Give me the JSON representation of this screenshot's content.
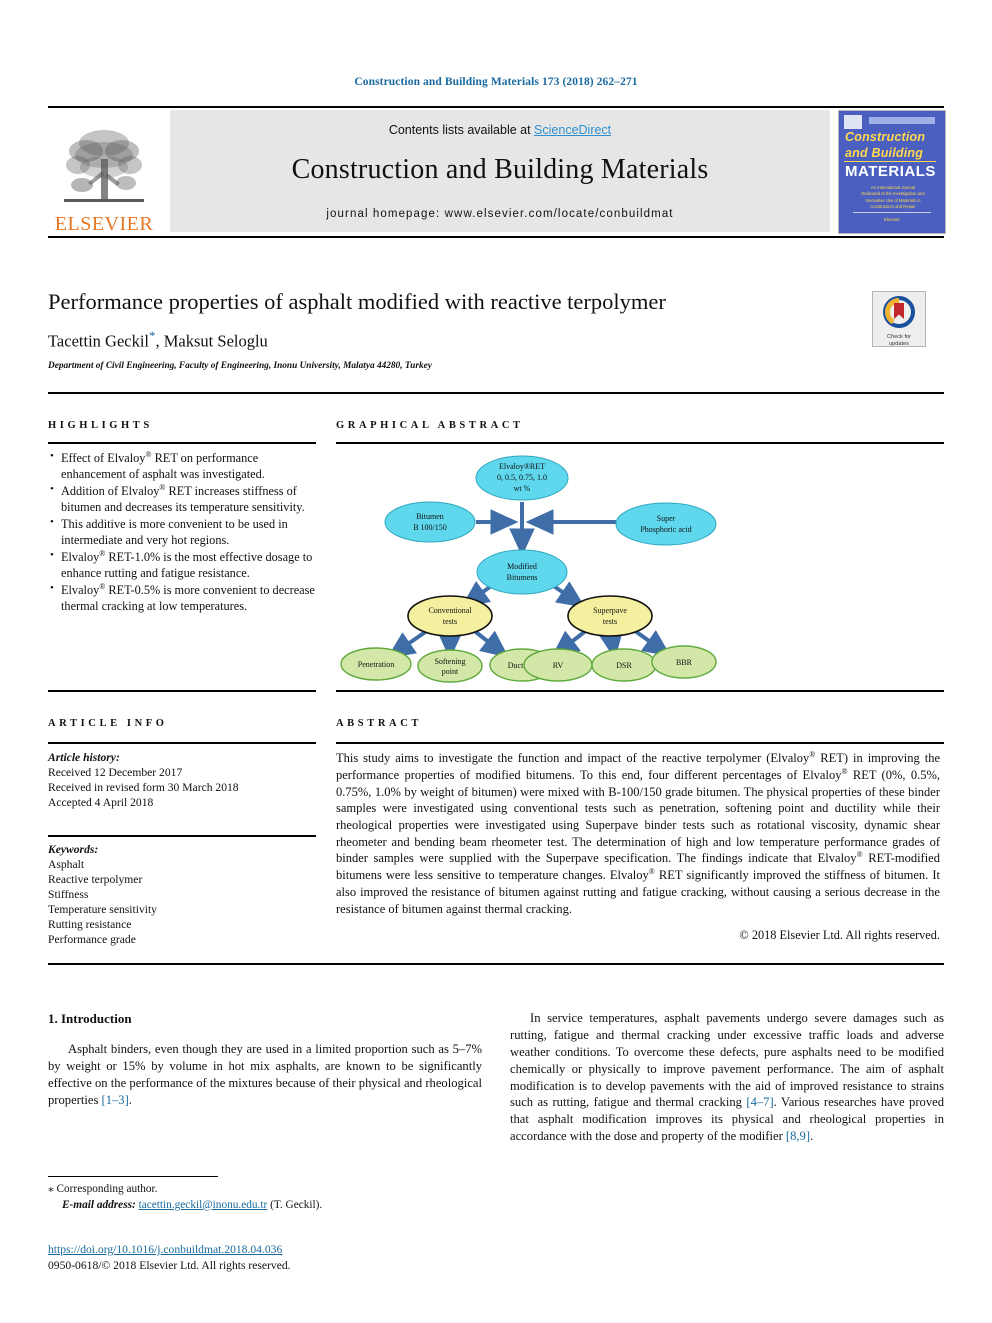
{
  "runninghead": "Construction and Building Materials 173 (2018) 262–271",
  "masthead": {
    "contents_prefix": "Contents lists available at ",
    "sciencedirect": "ScienceDirect",
    "journal_title": "Construction and Building Materials",
    "homepage": "journal homepage: www.elsevier.com/locate/conbuildmat",
    "publisher": "ELSEVIER",
    "cover": {
      "line1": "Construction",
      "line2": "and Building",
      "line3": "MATERIALS",
      "blurb": "An International Journal Dedicated to the Investigation and Innovative Use of Materials in Construction and Repair",
      "footer": "Elsevier"
    }
  },
  "title": "Performance properties of asphalt modified with reactive terpolymer",
  "authors": "Tacettin Geckil",
  "authors_rest": ", Maksut Seloglu",
  "corr_mark": "*",
  "affiliation": "Department of Civil Engineering, Faculty of Engineering, Inonu University, Malatya 44280, Turkey",
  "crossmark": {
    "line1": "Check for",
    "line2": "updates"
  },
  "highlights": {
    "label": "HIGHLIGHTS",
    "items": [
      "Effect of Elvaloy® RET on performance enhancement of asphalt was investigated.",
      "Addition of Elvaloy® RET increases stiffness of bitumen and decreases its temperature sensitivity.",
      "This additive is more convenient to be used in intermediate and very hot regions.",
      "Elvaloy® RET-1.0% is the most effective dosage to enhance rutting and fatigue resistance.",
      "Elvaloy® RET-0.5% is more convenient to decrease thermal cracking at low temperatures."
    ]
  },
  "graphical_abstract": {
    "label": "GRAPHICAL ABSTRACT",
    "nodes": {
      "elvaloy": "Elvaloy®RET\n0, 0.5, 0.75, 1.0\nwt %",
      "elvaloy_l1": "Elvaloy®RET",
      "elvaloy_l2": "0, 0.5, 0.75, 1.0",
      "elvaloy_l3": "wt %",
      "bitumen_l1": "Bitumen",
      "bitumen_l2": "B 100/150",
      "acid_l1": "Super",
      "acid_l2": "Phosphoric acid",
      "modified_l1": "Modified",
      "modified_l2": "Bitumens",
      "conventional_l1": "Conventional",
      "conventional_l2": "tests",
      "superpave_l1": "Superpave",
      "superpave_l2": "tests",
      "penetration": "Penetration",
      "softening_l1": "Softening",
      "softening_l2": "point",
      "ductility": "Ductility",
      "rv": "RV",
      "dsr": "DSR",
      "bbr": "BBR"
    },
    "colors": {
      "cyan": "#5FD8EE",
      "yellow": "#F5EFA0",
      "green": "#D3E8A8",
      "green_stroke": "#5FA83C",
      "arrow": "#3E6DA8"
    }
  },
  "article_info": {
    "label": "ARTICLE INFO",
    "history_label": "Article history:",
    "history": [
      "Received 12 December 2017",
      "Received in revised form 30 March 2018",
      "Accepted 4 April 2018"
    ],
    "keywords_label": "Keywords:",
    "keywords": [
      "Asphalt",
      "Reactive terpolymer",
      "Stiffness",
      "Temperature sensitivity",
      "Rutting resistance",
      "Performance grade"
    ]
  },
  "abstract": {
    "label": "ABSTRACT",
    "text_part1": "This study aims to investigate the function and impact of the reactive terpolymer (Elvaloy",
    "text_part2": " RET) in improving the performance properties of modified bitumens. To this end, four different percentages of Elvaloy",
    "text_part3": " RET (0%, 0.5%, 0.75%, 1.0% by weight of bitumen) were mixed with B-100/150 grade bitumen. The physical properties of these binder samples were investigated using conventional tests such as penetration, softening point and ductility while their rheological properties were investigated using Superpave binder tests such as rotational viscosity, dynamic shear rheometer and bending beam rheometer test. The determination of high and low temperature performance grades of binder samples were supplied with the Superpave specification. The findings indicate that Elvaloy",
    "text_part4": " RET-modified bitumens were less sensitive to temperature changes. Elvaloy",
    "text_part5": " RET significantly improved the stiffness of bitumen. It also improved the resistance of bitumen against rutting and fatigue cracking, without causing a serious decrease in the resistance of bitumen against thermal cracking.",
    "copyright": "© 2018 Elsevier Ltd. All rights reserved."
  },
  "body": {
    "section_heading": "1. Introduction",
    "left_paragraph_a": "Asphalt binders, even though they are used in a limited proportion such as 5–7% by weight or 15% by volume in hot mix asphalts, are known to be significantly effective on the performance of the mixtures because of their physical and rheological properties ",
    "left_ref_a": "[1–3]",
    "left_paragraph_a_end": ".",
    "right_paragraph_a": "In service temperatures, asphalt pavements undergo severe damages such as rutting, fatigue and thermal cracking under excessive traffic loads and adverse weather conditions. To overcome these defects, pure asphalts need to be modified chemically or physically to improve pavement performance. The aim of asphalt modification is to develop pavements with the aid of improved resistance to strains such as rutting, fatigue and thermal cracking ",
    "right_ref_a": "[4–7]",
    "right_paragraph_mid": ". Various researches have proved that asphalt modification improves its physical and rheological properties in accordance with the dose and property of the modifier ",
    "right_ref_b": "[8,9]",
    "right_paragraph_end": "."
  },
  "footer": {
    "corr_symbol": "⁎",
    "corr_text": "Corresponding author.",
    "email_label": "E-mail address:",
    "email": "tacettin.geckil@inonu.edu.tr",
    "email_suffix": " (T. Geckil).",
    "doi": "https://doi.org/10.1016/j.conbuildmat.2018.04.036",
    "issn_line": "0950-0618/© 2018 Elsevier Ltd. All rights reserved."
  }
}
